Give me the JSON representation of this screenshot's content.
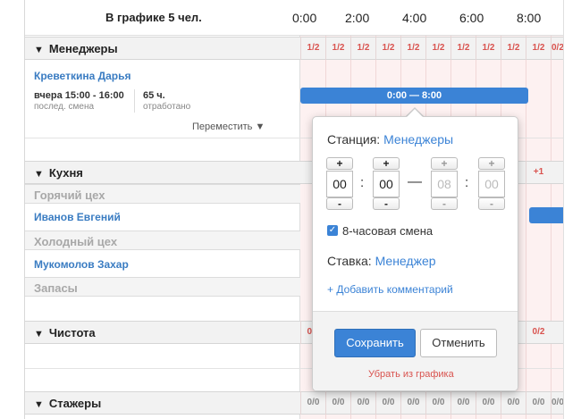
{
  "header": {
    "title": "В графике 5 чел.",
    "hours": [
      "0:00",
      "2:00",
      "4:00",
      "6:00",
      "8:00"
    ]
  },
  "groups": [
    {
      "name": "Менеджеры",
      "cells": [
        "1/2",
        "1/2",
        "1/2",
        "1/2",
        "1/2",
        "1/2",
        "1/2",
        "1/2",
        "1/2",
        "1/2",
        "0/2"
      ]
    },
    {
      "name": "Кухня",
      "cells": [
        "+1"
      ]
    },
    {
      "name": "Чистота",
      "cells": [
        "0/2",
        "0/2",
        "0/2",
        "0/2",
        "0/2",
        "0/2",
        "0/2",
        "0/2",
        "0/2",
        "0/2"
      ]
    },
    {
      "name": "Стажеры",
      "cells": [
        "0/0",
        "0/0",
        "0/0",
        "0/0",
        "0/0",
        "0/0",
        "0/0",
        "0/0",
        "0/0",
        "0/0",
        "0/0"
      ]
    }
  ],
  "subgroups": [
    "Горячий цех",
    "Холодный цех",
    "Запасы"
  ],
  "employees": {
    "darya": {
      "name": "Креветкина Дарья",
      "last_shift": "вчера 15:00 - 16:00",
      "last_shift_label": "послед. смена",
      "hours": "65 ч.",
      "hours_label": "отработано",
      "move": "Переместить ▼",
      "shift": "0:00 — 8:00"
    },
    "ivanov": {
      "name": "Иванов Евгений"
    },
    "mukomolov": {
      "name": "Мукомолов Захар"
    }
  },
  "popover": {
    "station_label": "Станция:",
    "station_value": "Менеджеры",
    "start_hour": "00",
    "start_min": "00",
    "end_hour": "08",
    "end_min": "00",
    "plus": "+",
    "minus": "-",
    "checkbox_label": "8-часовая смена",
    "rate_label": "Ставка:",
    "rate_value": "Менеджер",
    "add_comment": "+ Добавить комментарий",
    "save": "Сохранить",
    "cancel": "Отменить",
    "remove": "Убрать из графика"
  },
  "colors": {
    "accent": "#3b83d6",
    "danger": "#d9534f",
    "timeline_bg": "#fdf1f1"
  }
}
